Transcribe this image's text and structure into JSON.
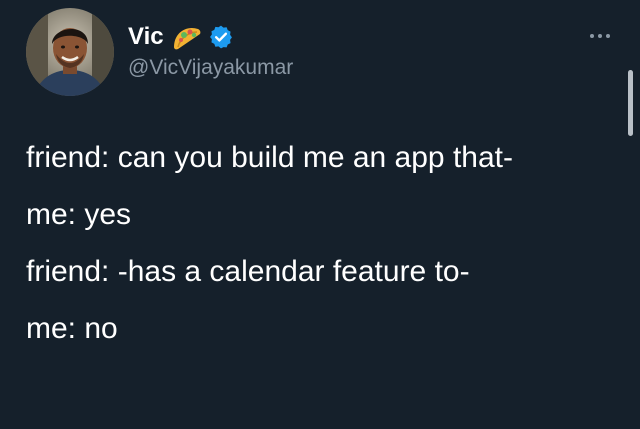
{
  "author": {
    "display_name": "Vic",
    "handle": "@VicVijayakumar",
    "badge_icon": "taco-icon",
    "verified_icon": "verified-badge-icon",
    "verified_color": "#1d9bf0"
  },
  "menu": {
    "icon": "more-options-icon"
  },
  "tweet": {
    "lines": [
      "friend: can you build me an app that-",
      "me: yes",
      "friend: -has a calendar feature to-",
      "me: no"
    ]
  },
  "theme": {
    "background": "#15202b",
    "text": "#ffffff",
    "secondary_text": "#8b98a5"
  }
}
